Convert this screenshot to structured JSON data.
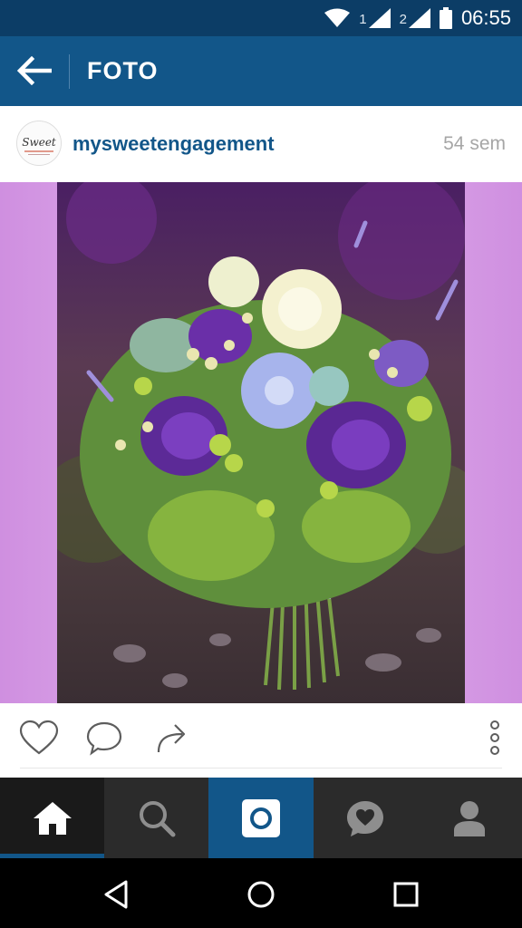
{
  "status_bar": {
    "time": "06:55",
    "sim1": "1",
    "sim2": "2"
  },
  "app_bar": {
    "title": "FOTO"
  },
  "post": {
    "username": "mysweetengagement",
    "time_ago": "54 sem",
    "avatar_text": "Sweet"
  },
  "icons": {
    "back": "arrow-left-icon",
    "like": "heart-icon",
    "comment": "comment-bubble-icon",
    "share": "share-arrow-icon",
    "more": "vertical-dots-icon",
    "home": "home-icon",
    "search": "search-icon",
    "camera": "camera-icon",
    "activity": "heart-bubble-icon",
    "profile": "person-icon"
  },
  "colors": {
    "status_bar": "#0c3d66",
    "app_bar": "#125689",
    "username": "#125689",
    "tab_bar": "#2b2b2b",
    "photo_background": "#e1b0ec"
  }
}
